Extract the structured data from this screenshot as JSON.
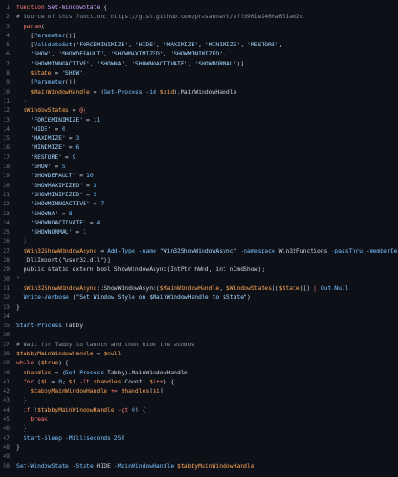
{
  "code": {
    "lines": [
      {
        "n": "1",
        "t": [
          [
            "kw",
            "function "
          ],
          [
            "fn",
            "Set-WindowState"
          ],
          [
            "plain",
            " {"
          ]
        ]
      },
      {
        "n": "2",
        "t": [
          [
            "cmt",
            "# Source of this function: https://gist.github.com/prasannavl/effd901e2460a651ad2c"
          ]
        ]
      },
      {
        "n": "3",
        "t": [
          [
            "plain",
            "  "
          ],
          [
            "kw",
            "param"
          ],
          [
            "plain",
            "("
          ]
        ]
      },
      {
        "n": "4",
        "t": [
          [
            "plain",
            "    ["
          ],
          [
            "type",
            "Parameter"
          ],
          [
            "plain",
            "()]"
          ]
        ]
      },
      {
        "n": "5",
        "t": [
          [
            "plain",
            "    ["
          ],
          [
            "type",
            "ValidateSet"
          ],
          [
            "plain",
            "("
          ],
          [
            "str",
            "'FORCEMINIMIZE'"
          ],
          [
            "plain",
            ", "
          ],
          [
            "str",
            "'HIDE'"
          ],
          [
            "plain",
            ", "
          ],
          [
            "str",
            "'MAXIMIZE'"
          ],
          [
            "plain",
            ", "
          ],
          [
            "str",
            "'MINIMIZE'"
          ],
          [
            "plain",
            ", "
          ],
          [
            "str",
            "'RESTORE'"
          ],
          [
            "plain",
            ","
          ]
        ]
      },
      {
        "n": "6",
        "t": [
          [
            "plain",
            "    "
          ],
          [
            "str",
            "'SHOW'"
          ],
          [
            "plain",
            ", "
          ],
          [
            "str",
            "'SHOWDEFAULT'"
          ],
          [
            "plain",
            ", "
          ],
          [
            "str",
            "'SHOWMAXIMIZED'"
          ],
          [
            "plain",
            ", "
          ],
          [
            "str",
            "'SHOWMINIMIZED'"
          ],
          [
            "plain",
            ","
          ]
        ]
      },
      {
        "n": "7",
        "t": [
          [
            "plain",
            "    "
          ],
          [
            "str",
            "'SHOWMINNOACTIVE'"
          ],
          [
            "plain",
            ", "
          ],
          [
            "str",
            "'SHOWNA'"
          ],
          [
            "plain",
            ", "
          ],
          [
            "str",
            "'SHOWNOACTIVATE'"
          ],
          [
            "plain",
            ", "
          ],
          [
            "str",
            "'SHOWNORMAL'"
          ],
          [
            "plain",
            ")]"
          ]
        ]
      },
      {
        "n": "8",
        "t": [
          [
            "plain",
            "    "
          ],
          [
            "var",
            "$State"
          ],
          [
            "plain",
            " = "
          ],
          [
            "str",
            "'SHOW'"
          ],
          [
            "plain",
            ","
          ]
        ]
      },
      {
        "n": "9",
        "t": [
          [
            "plain",
            "    ["
          ],
          [
            "type",
            "Parameter"
          ],
          [
            "plain",
            "()]"
          ]
        ]
      },
      {
        "n": "10",
        "t": [
          [
            "plain",
            "    "
          ],
          [
            "var",
            "$MainWindowHandle"
          ],
          [
            "plain",
            " = ("
          ],
          [
            "cmd",
            "Get-Process"
          ],
          [
            "plain",
            " "
          ],
          [
            "attr",
            "-id"
          ],
          [
            "plain",
            " "
          ],
          [
            "var",
            "$pid"
          ],
          [
            "plain",
            ").MainWindowHandle"
          ]
        ]
      },
      {
        "n": "11",
        "t": [
          [
            "plain",
            "  )"
          ]
        ]
      },
      {
        "n": "12",
        "t": [
          [
            "plain",
            "  "
          ],
          [
            "var",
            "$WindowStates"
          ],
          [
            "plain",
            " = "
          ],
          [
            "op",
            "@{"
          ]
        ]
      },
      {
        "n": "13",
        "t": [
          [
            "plain",
            "    "
          ],
          [
            "str",
            "'FORCEMINIMIZE'"
          ],
          [
            "plain",
            " = "
          ],
          [
            "num",
            "11"
          ]
        ]
      },
      {
        "n": "14",
        "t": [
          [
            "plain",
            "    "
          ],
          [
            "str",
            "'HIDE'"
          ],
          [
            "plain",
            " = "
          ],
          [
            "num",
            "0"
          ]
        ]
      },
      {
        "n": "15",
        "t": [
          [
            "plain",
            "    "
          ],
          [
            "str",
            "'MAXIMIZE'"
          ],
          [
            "plain",
            " = "
          ],
          [
            "num",
            "3"
          ]
        ]
      },
      {
        "n": "16",
        "t": [
          [
            "plain",
            "    "
          ],
          [
            "str",
            "'MINIMIZE'"
          ],
          [
            "plain",
            " = "
          ],
          [
            "num",
            "6"
          ]
        ]
      },
      {
        "n": "17",
        "t": [
          [
            "plain",
            "    "
          ],
          [
            "str",
            "'RESTORE'"
          ],
          [
            "plain",
            " = "
          ],
          [
            "num",
            "9"
          ]
        ]
      },
      {
        "n": "18",
        "t": [
          [
            "plain",
            "    "
          ],
          [
            "str",
            "'SHOW'"
          ],
          [
            "plain",
            " = "
          ],
          [
            "num",
            "5"
          ]
        ]
      },
      {
        "n": "19",
        "t": [
          [
            "plain",
            "    "
          ],
          [
            "str",
            "'SHOWDEFAULT'"
          ],
          [
            "plain",
            " = "
          ],
          [
            "num",
            "10"
          ]
        ]
      },
      {
        "n": "20",
        "t": [
          [
            "plain",
            "    "
          ],
          [
            "str",
            "'SHOWMAXIMIZED'"
          ],
          [
            "plain",
            " = "
          ],
          [
            "num",
            "3"
          ]
        ]
      },
      {
        "n": "21",
        "t": [
          [
            "plain",
            "    "
          ],
          [
            "str",
            "'SHOWMINIMIZED'"
          ],
          [
            "plain",
            " = "
          ],
          [
            "num",
            "2"
          ]
        ]
      },
      {
        "n": "22",
        "t": [
          [
            "plain",
            "    "
          ],
          [
            "str",
            "'SHOWMINNOACTIVE'"
          ],
          [
            "plain",
            " = "
          ],
          [
            "num",
            "7"
          ]
        ]
      },
      {
        "n": "23",
        "t": [
          [
            "plain",
            "    "
          ],
          [
            "str",
            "'SHOWNA'"
          ],
          [
            "plain",
            " = "
          ],
          [
            "num",
            "8"
          ]
        ]
      },
      {
        "n": "24",
        "t": [
          [
            "plain",
            "    "
          ],
          [
            "str",
            "'SHOWNOACTIVATE'"
          ],
          [
            "plain",
            " = "
          ],
          [
            "num",
            "4"
          ]
        ]
      },
      {
        "n": "25",
        "t": [
          [
            "plain",
            "    "
          ],
          [
            "str",
            "'SHOWNORMAL'"
          ],
          [
            "plain",
            " = "
          ],
          [
            "num",
            "1"
          ]
        ]
      },
      {
        "n": "26",
        "t": [
          [
            "plain",
            "  }"
          ]
        ]
      },
      {
        "n": "27",
        "t": [
          [
            "plain",
            "  "
          ],
          [
            "var",
            "$Win32ShowWindowAsync"
          ],
          [
            "plain",
            " = "
          ],
          [
            "cmd",
            "Add-Type"
          ],
          [
            "plain",
            " "
          ],
          [
            "attr",
            "-name"
          ],
          [
            "plain",
            " "
          ],
          [
            "str",
            "\"Win32ShowWindowAsync\""
          ],
          [
            "plain",
            " "
          ],
          [
            "attr",
            "-namespace"
          ],
          [
            "plain",
            " Win32Functions "
          ],
          [
            "attr",
            "-passThru"
          ],
          [
            "plain",
            " "
          ],
          [
            "attr",
            "-memberDefinition"
          ],
          [
            "plain",
            " '"
          ]
        ]
      },
      {
        "n": "28",
        "t": [
          [
            "plain",
            "  [DllImport(\"user32.dll\")]"
          ]
        ]
      },
      {
        "n": "29",
        "t": [
          [
            "plain",
            "  public static extern bool ShowWindowAsync(IntPtr hWnd, int nCmdShow);"
          ]
        ]
      },
      {
        "n": "30",
        "t": [
          [
            "plain",
            "'"
          ]
        ]
      },
      {
        "n": "31",
        "t": [
          [
            "plain",
            "  "
          ],
          [
            "var",
            "$Win32ShowWindowAsync"
          ],
          [
            "plain",
            "::ShowWindowAsync("
          ],
          [
            "var",
            "$MainWindowHandle"
          ],
          [
            "plain",
            ", "
          ],
          [
            "var",
            "$WindowStates"
          ],
          [
            "plain",
            "[("
          ],
          [
            "var",
            "$State"
          ],
          [
            "plain",
            ")]) "
          ],
          [
            "op",
            "|"
          ],
          [
            "plain",
            " "
          ],
          [
            "cmd",
            "Out-Null"
          ]
        ]
      },
      {
        "n": "32",
        "t": [
          [
            "plain",
            "  "
          ],
          [
            "cmd",
            "Write-Verbose"
          ],
          [
            "plain",
            " ("
          ],
          [
            "str",
            "\"Set Window Style on $MainWindowHandle to $State\""
          ],
          [
            "plain",
            ")"
          ]
        ]
      },
      {
        "n": "33",
        "t": [
          [
            "plain",
            "}"
          ]
        ]
      },
      {
        "n": "34",
        "t": []
      },
      {
        "n": "35",
        "t": [
          [
            "cmd",
            "Start-Process"
          ],
          [
            "plain",
            " Tabby"
          ]
        ]
      },
      {
        "n": "36",
        "t": []
      },
      {
        "n": "37",
        "t": [
          [
            "cmt",
            "# Wait for Tabby to launch and then hide the window"
          ]
        ]
      },
      {
        "n": "38",
        "t": [
          [
            "var",
            "$tabbyMainWindowHandle"
          ],
          [
            "plain",
            " = "
          ],
          [
            "var",
            "$null"
          ]
        ]
      },
      {
        "n": "39",
        "t": [
          [
            "kw",
            "while"
          ],
          [
            "plain",
            " ("
          ],
          [
            "var",
            "$true"
          ],
          [
            "plain",
            ") {"
          ]
        ]
      },
      {
        "n": "40",
        "t": [
          [
            "plain",
            "  "
          ],
          [
            "var",
            "$handles"
          ],
          [
            "plain",
            " = ("
          ],
          [
            "cmd",
            "Get-Process"
          ],
          [
            "plain",
            " Tabby).MainWindowHandle"
          ]
        ]
      },
      {
        "n": "41",
        "t": [
          [
            "plain",
            "  "
          ],
          [
            "kw",
            "for"
          ],
          [
            "plain",
            " ("
          ],
          [
            "var",
            "$i"
          ],
          [
            "plain",
            " = "
          ],
          [
            "num",
            "0"
          ],
          [
            "plain",
            "; "
          ],
          [
            "var",
            "$i"
          ],
          [
            "plain",
            " "
          ],
          [
            "op",
            "-lt"
          ],
          [
            "plain",
            " "
          ],
          [
            "var",
            "$handles"
          ],
          [
            "plain",
            ".Count; "
          ],
          [
            "var",
            "$i"
          ],
          [
            "op",
            "++"
          ],
          [
            "plain",
            ") {"
          ]
        ]
      },
      {
        "n": "42",
        "t": [
          [
            "plain",
            "    "
          ],
          [
            "var",
            "$tabbyMainWindowHandle"
          ],
          [
            "plain",
            " "
          ],
          [
            "op",
            "+="
          ],
          [
            "plain",
            " "
          ],
          [
            "var",
            "$handles"
          ],
          [
            "plain",
            "["
          ],
          [
            "var",
            "$i"
          ],
          [
            "plain",
            "]"
          ]
        ]
      },
      {
        "n": "43",
        "t": [
          [
            "plain",
            "  }"
          ]
        ]
      },
      {
        "n": "44",
        "t": [
          [
            "plain",
            "  "
          ],
          [
            "kw",
            "if"
          ],
          [
            "plain",
            " ("
          ],
          [
            "var",
            "$tabbyMainWindowHandle"
          ],
          [
            "plain",
            " "
          ],
          [
            "op",
            "-gt"
          ],
          [
            "plain",
            " "
          ],
          [
            "num",
            "0"
          ],
          [
            "plain",
            ") {"
          ]
        ]
      },
      {
        "n": "45",
        "t": [
          [
            "plain",
            "    "
          ],
          [
            "kw",
            "break"
          ]
        ]
      },
      {
        "n": "46",
        "t": [
          [
            "plain",
            "  }"
          ]
        ]
      },
      {
        "n": "47",
        "t": [
          [
            "plain",
            "  "
          ],
          [
            "cmd",
            "Start-Sleep"
          ],
          [
            "plain",
            " "
          ],
          [
            "attr",
            "-Milliseconds"
          ],
          [
            "plain",
            " "
          ],
          [
            "num",
            "250"
          ]
        ]
      },
      {
        "n": "48",
        "t": [
          [
            "plain",
            "}"
          ]
        ]
      },
      {
        "n": "49",
        "t": []
      },
      {
        "n": "50",
        "t": [
          [
            "cmd",
            "Set-WindowState"
          ],
          [
            "plain",
            " "
          ],
          [
            "attr",
            "-State"
          ],
          [
            "plain",
            " HIDE "
          ],
          [
            "attr",
            "-MainWindowHandle"
          ],
          [
            "plain",
            " "
          ],
          [
            "var",
            "$tabbyMainWindowHandle"
          ]
        ]
      }
    ]
  },
  "colors": {
    "background": "#0d1117",
    "line_number": "#6e7681",
    "keyword": "#ff7b72",
    "function": "#d2a8ff",
    "string": "#a5d6ff",
    "variable": "#ffa657",
    "comment": "#8b949e",
    "command": "#79c0ff"
  }
}
